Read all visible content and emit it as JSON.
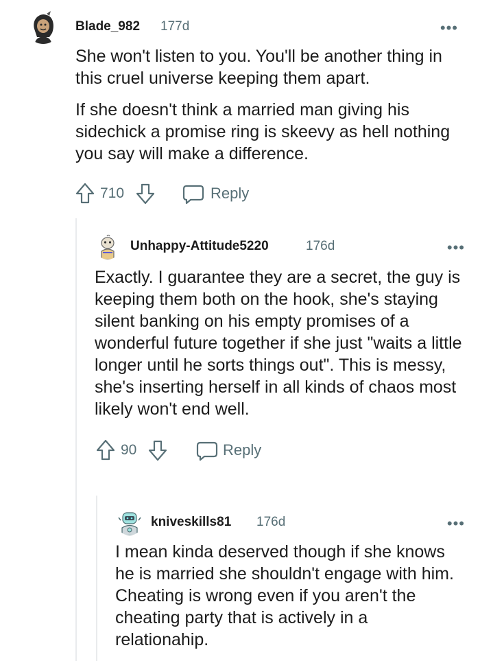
{
  "comments": [
    {
      "username": "Blade_982",
      "age": "177d",
      "more": "•••",
      "paragraphs": [
        "She won't listen to you. You'll be another thing in this cruel universe keeping them apart.",
        "If she doesn't think a married man giving his sidechick a promise ring is skeevy as hell nothing you say will make a difference."
      ],
      "score": "710",
      "reply_label": "Reply"
    },
    {
      "username": "Unhappy-Attitude5220",
      "age": "176d",
      "more": "•••",
      "paragraphs": [
        "Exactly. I guarantee they are a secret, the guy is keeping them both on the hook, she's staying silent banking on his empty promises of a wonderful future together if she just \"waits a little longer until he sorts things out\". This is messy, she's inserting herself in all kinds of chaos most likely won't end well."
      ],
      "score": "90",
      "reply_label": "Reply"
    },
    {
      "username": "kniveskills81",
      "age": "176d",
      "more": "•••",
      "paragraphs": [
        "I mean kinda deserved though if she knows he is married she shouldn't engage with him. Cheating is wrong even if you aren't the cheating party that is actively in a relationahip."
      ]
    }
  ],
  "icons": {
    "upvote": "upvote-arrow-icon",
    "downvote": "downvote-arrow-icon",
    "reply": "speech-bubble-icon",
    "more": "more-options-icon"
  },
  "colors": {
    "text": "#1c1c1c",
    "meta": "#576f76",
    "thread_line": "#e9ebed"
  }
}
